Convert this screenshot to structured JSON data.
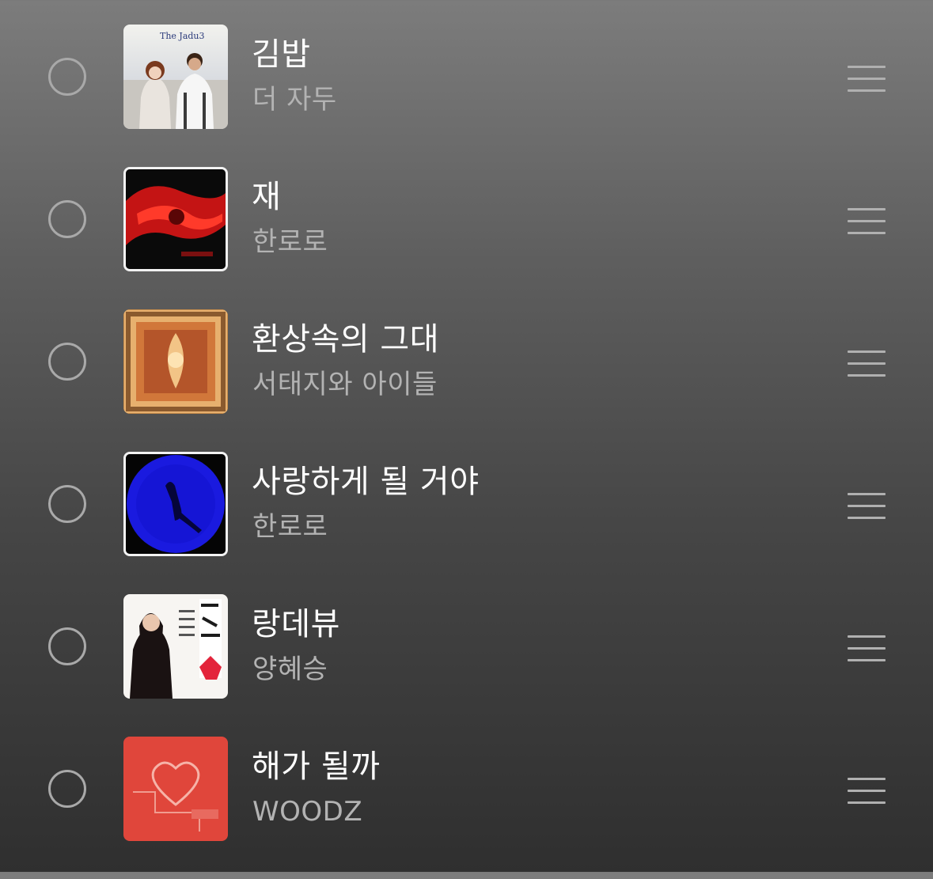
{
  "tracks": [
    {
      "title": "김밥",
      "artist": "더 자두",
      "art_label": "The Jadu3",
      "art_icon": "album-art-jadu"
    },
    {
      "title": "재",
      "artist": "한로로",
      "art_label": "",
      "art_icon": "album-art-red"
    },
    {
      "title": "환상속의 그대",
      "artist": "서태지와 아이들",
      "art_label": "",
      "art_icon": "album-art-ornate"
    },
    {
      "title": "사랑하게 될 거야",
      "artist": "한로로",
      "art_label": "",
      "art_icon": "album-art-blue"
    },
    {
      "title": "랑데뷰",
      "artist": "양혜승",
      "art_label": "",
      "art_icon": "album-art-portrait"
    },
    {
      "title": "해가 될까",
      "artist": "WOODZ",
      "art_label": "",
      "art_icon": "album-art-heart"
    }
  ],
  "colors": {
    "title": "#ffffff",
    "artist": "#b3b3b3",
    "control": "#a9a9a9"
  }
}
